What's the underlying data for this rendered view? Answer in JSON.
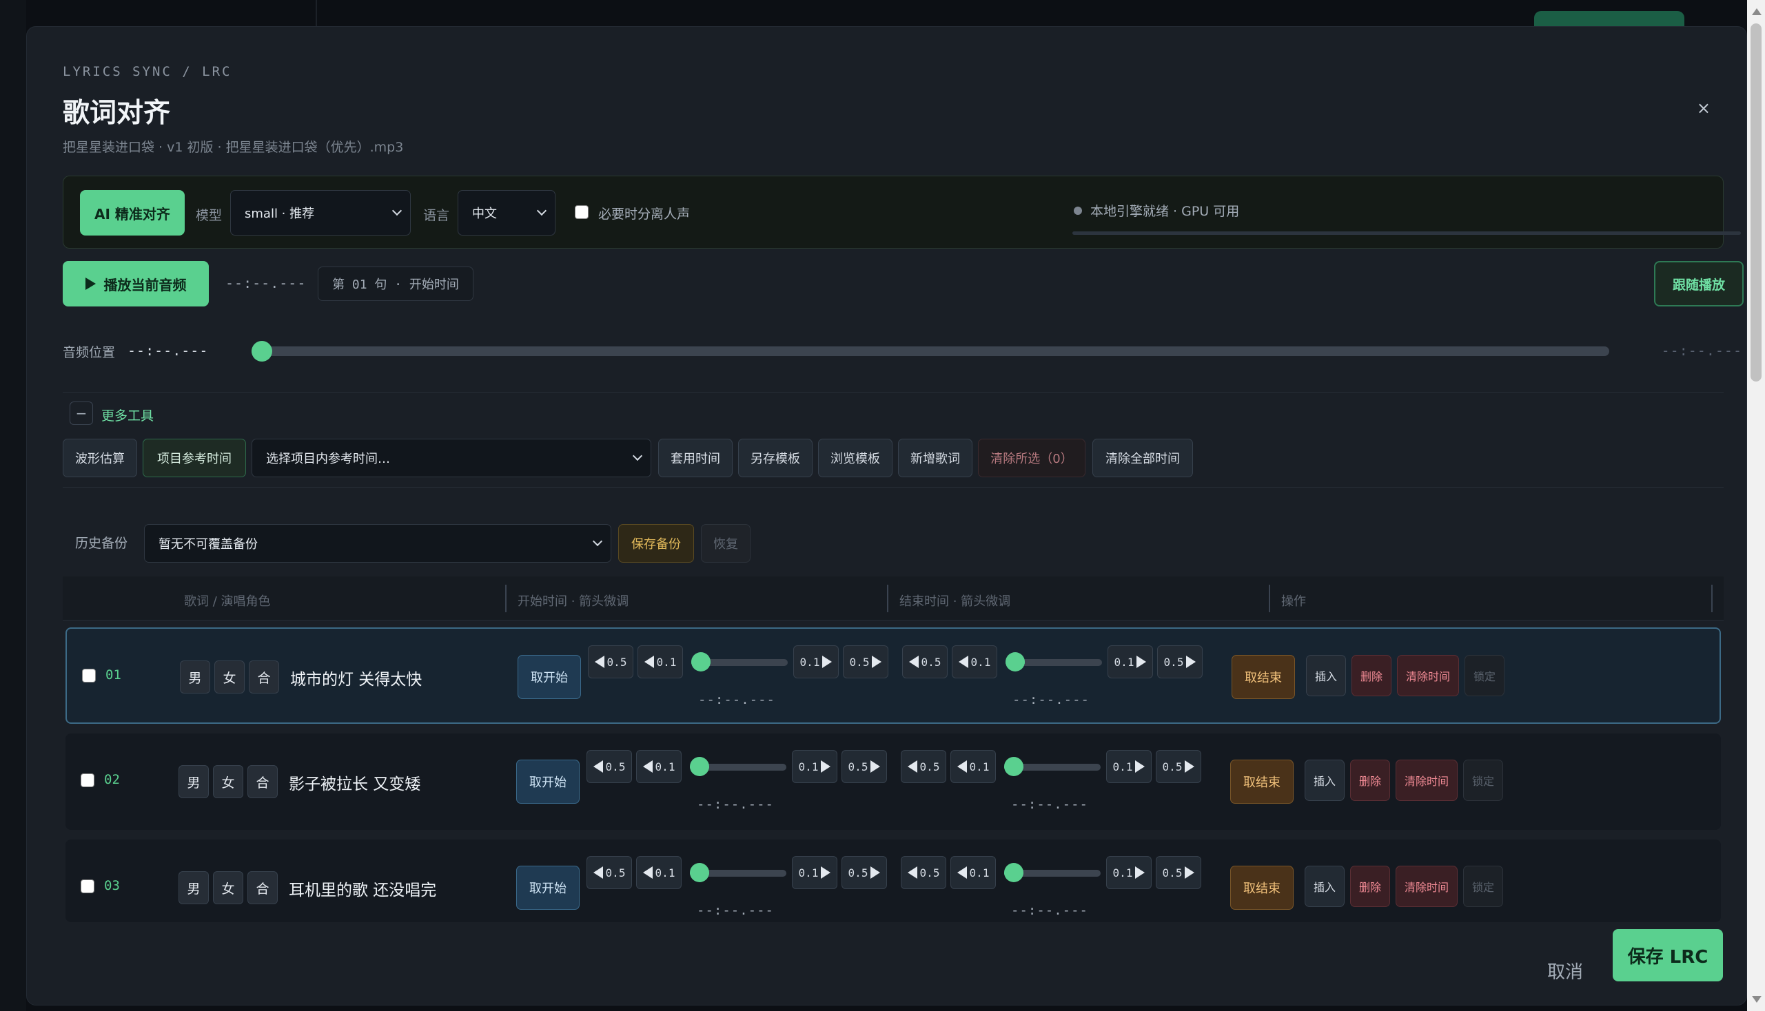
{
  "window": {
    "eyebrow": "LYRICS SYNC / LRC",
    "title": "歌词对齐",
    "subtitle": "把星星装进口袋 · v1 初版 · 把星星装进口袋（优先）.mp3",
    "close_label": "×"
  },
  "ai": {
    "button": "AI 精准对齐",
    "model_label": "模型",
    "model_value": "small · 推荐",
    "language_label": "语言",
    "language_value": "中文",
    "separate_vocals_label": "必要时分离人声",
    "separate_vocals_checked": false,
    "engine_status": "本地引擎就绪 · GPU 可用"
  },
  "playback": {
    "play_label": "播放当前音频",
    "current_time": "--:--.---",
    "line_chip": "第 01 句 · 开始时间",
    "follow_label": "跟随播放"
  },
  "position": {
    "label": "音频位置",
    "current": "--:--.---",
    "end": "--:--.---",
    "progress": 0.0
  },
  "tools": {
    "toggle_symbol": "−",
    "label": "更多工具",
    "waveform": "波形估算",
    "project_ref": "项目参考时间",
    "ref_select": "选择项目内参考时间…",
    "apply_time": "套用时间",
    "save_template": "另存模板",
    "browse_template": "浏览模板",
    "add_lyric": "新增歌词",
    "clear_selected": "清除所选（0）",
    "clear_all": "清除全部时间"
  },
  "history": {
    "label": "历史备份",
    "select_value": "暂无不可覆盖备份",
    "save_backup": "保存备份",
    "restore": "恢复"
  },
  "table": {
    "headers": [
      "歌词 / 演唱角色",
      "开始时间 · 箭头微调",
      "结束时间 · 箭头微调",
      "操作"
    ],
    "roles": [
      "男",
      "女",
      "合"
    ],
    "take_start": "取开始",
    "take_end": "取结束",
    "nudge_big": "0.5",
    "nudge_small": "0.1",
    "actions": {
      "insert": "插入",
      "delete": "删除",
      "clear": "清除时间",
      "lock": "锁定"
    },
    "rows": [
      {
        "num": "01",
        "lyric": "城市的灯 关得太快",
        "start": "--:--.---",
        "end": "--:--.---",
        "active": true
      },
      {
        "num": "02",
        "lyric": "影子被拉长 又变矮",
        "start": "--:--.---",
        "end": "--:--.---",
        "active": false
      },
      {
        "num": "03",
        "lyric": "耳机里的歌 还没唱完",
        "start": "--:--.---",
        "end": "--:--.---",
        "active": false
      }
    ]
  },
  "footer": {
    "cancel": "取消",
    "save": "保存 LRC"
  },
  "colors": {
    "accent": "#5ad08f",
    "danger": "#f08a94",
    "warning": "#e0b85a",
    "background": "#1a1f26"
  }
}
